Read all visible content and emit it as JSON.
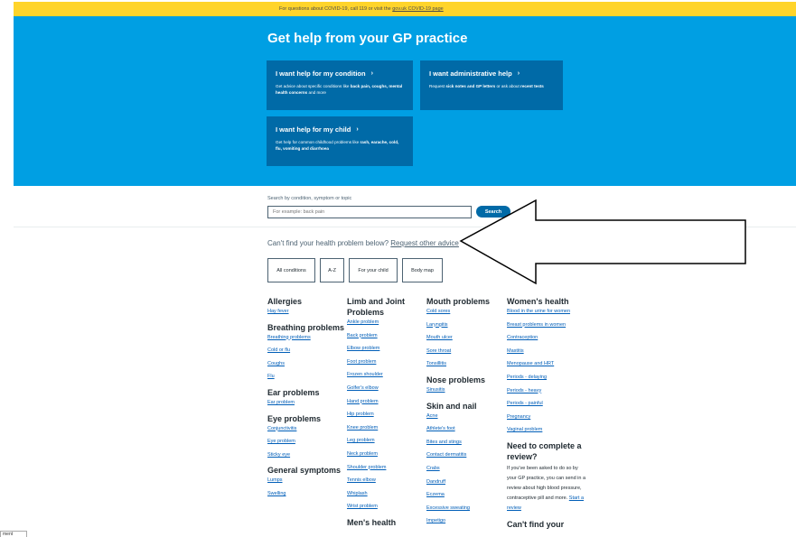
{
  "banner": {
    "prefix": "For questions about COVID-19, call 119 or visit the ",
    "link": "gov.uk COVID-19 page"
  },
  "hero": {
    "title": "Get help from your GP practice",
    "cards": {
      "condition": {
        "title": "I want help for my condition",
        "desc_parts": [
          "Get advice about specific conditions like ",
          "back pain, coughs, mental health concerns",
          " and more"
        ]
      },
      "admin": {
        "title": "I want administrative help",
        "desc_parts": [
          "Request ",
          "sick notes and GP letters",
          " or ask about ",
          "recent tests"
        ]
      },
      "child": {
        "title": "I want help for my child",
        "desc_parts": [
          "Get help for common childhood problems like ",
          "rash, earache, cold, flu, vomiting and diarrhoea"
        ]
      }
    },
    "chevron": "›"
  },
  "search": {
    "label": "Search by condition, symptom or topic",
    "placeholder": "For example: back pain",
    "button": "Search"
  },
  "cant_find": {
    "text": "Can't find your health problem below? ",
    "link": "Request other advice"
  },
  "filter_tabs": [
    "All conditions",
    "A-Z",
    "For your child",
    "Body map"
  ],
  "columns": {
    "col1": [
      {
        "head": "Allergies",
        "links": [
          "Hay fever"
        ]
      },
      {
        "head": "Breathing problems",
        "links": [
          "Breathing problems",
          "Cold or flu",
          "Coughs",
          "Flu"
        ]
      },
      {
        "head": "Ear problems",
        "links": [
          "Ear problem"
        ]
      },
      {
        "head": "Eye problems",
        "links": [
          "Conjunctivitis",
          "Eye problem",
          "Sticky eye"
        ]
      },
      {
        "head": "General symptoms",
        "links": [
          "Lumps",
          "Swelling"
        ]
      }
    ],
    "col2": [
      {
        "head": "Limb and Joint Problems",
        "links": [
          "Ankle problem",
          "Back problem",
          "Elbow problem",
          "Foot problem",
          "Frozen shoulder",
          "Golfer's elbow",
          "Hand problem",
          "Hip problem",
          "Knee problem",
          "Leg problem",
          "Neck problem",
          "Shoulder problem",
          "Tennis elbow",
          "Whiplash",
          "Wrist problem"
        ]
      },
      {
        "head": "Men's health",
        "links": []
      }
    ],
    "col3": [
      {
        "head": "Mouth problems",
        "links": [
          "Cold sores",
          "Laryngitis",
          "Mouth ulcer",
          "Sore throat",
          "Tonsillitis"
        ]
      },
      {
        "head": "Nose problems",
        "links": [
          "Sinusitis"
        ]
      },
      {
        "head": "Skin and nail",
        "links": [
          "Acne",
          "Athlete's foot",
          "Bites and stings",
          "Contact dermatitis",
          "Crabs",
          "Dandruff",
          "Eczema",
          "Excessive sweating",
          "Impetigo"
        ]
      }
    ],
    "col4": [
      {
        "head": "Women's health",
        "links": [
          "Blood in the urine for women",
          "Breast problems in women",
          "Contraception",
          "Mastitis",
          "Menopause and HRT",
          "Periods - delaying",
          "Periods - heavy",
          "Periods - painful",
          "Pregnancy",
          "Vaginal problem"
        ]
      }
    ],
    "review": {
      "head": "Need to complete a review?",
      "text": "If you've been asked to do so by your GP practice, you can send in a review about high blood pressure, contraceptive pill and more. ",
      "link": "Start a review"
    },
    "cant_find_your": "Can't find your"
  },
  "bottom_stub": "ment",
  "colors": {
    "banner": "#ffd42b",
    "hero": "#009fe3",
    "card": "#006aa7",
    "link": "#005eb8"
  }
}
